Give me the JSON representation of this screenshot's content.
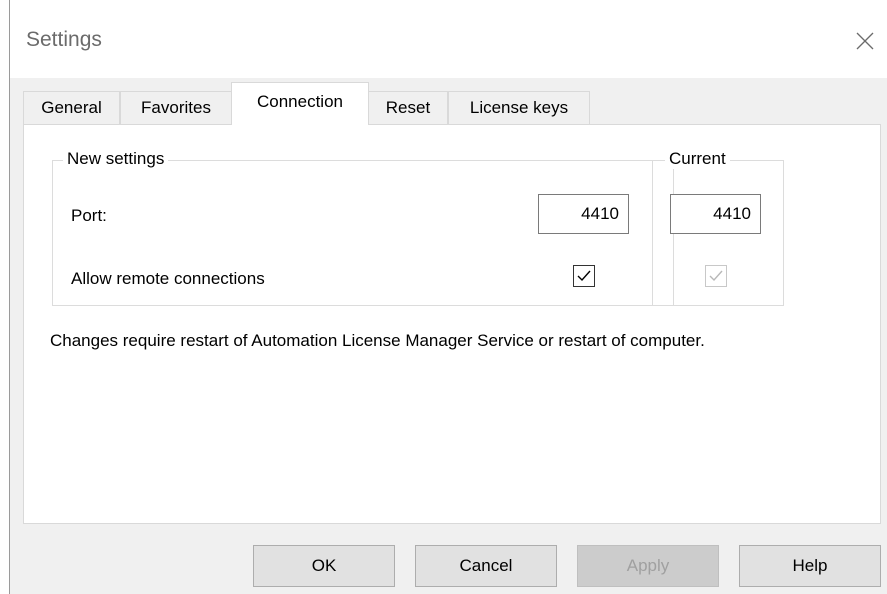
{
  "window": {
    "title": "Settings",
    "close_icon": "close-icon"
  },
  "tabs": [
    {
      "label": "General",
      "active": false
    },
    {
      "label": "Favorites",
      "active": false
    },
    {
      "label": "Connection",
      "active": true
    },
    {
      "label": "Reset",
      "active": false
    },
    {
      "label": "License keys",
      "active": false
    }
  ],
  "new_settings": {
    "legend": "New settings",
    "port_label": "Port:",
    "port_value": "4410",
    "remote_label": "Allow remote connections",
    "remote_checked": true
  },
  "current": {
    "legend": "Current",
    "port_value": "4410",
    "remote_checked": true,
    "remote_enabled": false
  },
  "note": "Changes require restart of Automation License Manager Service or restart of computer.",
  "buttons": {
    "ok": "OK",
    "cancel": "Cancel",
    "apply": "Apply",
    "apply_enabled": false,
    "help": "Help"
  }
}
